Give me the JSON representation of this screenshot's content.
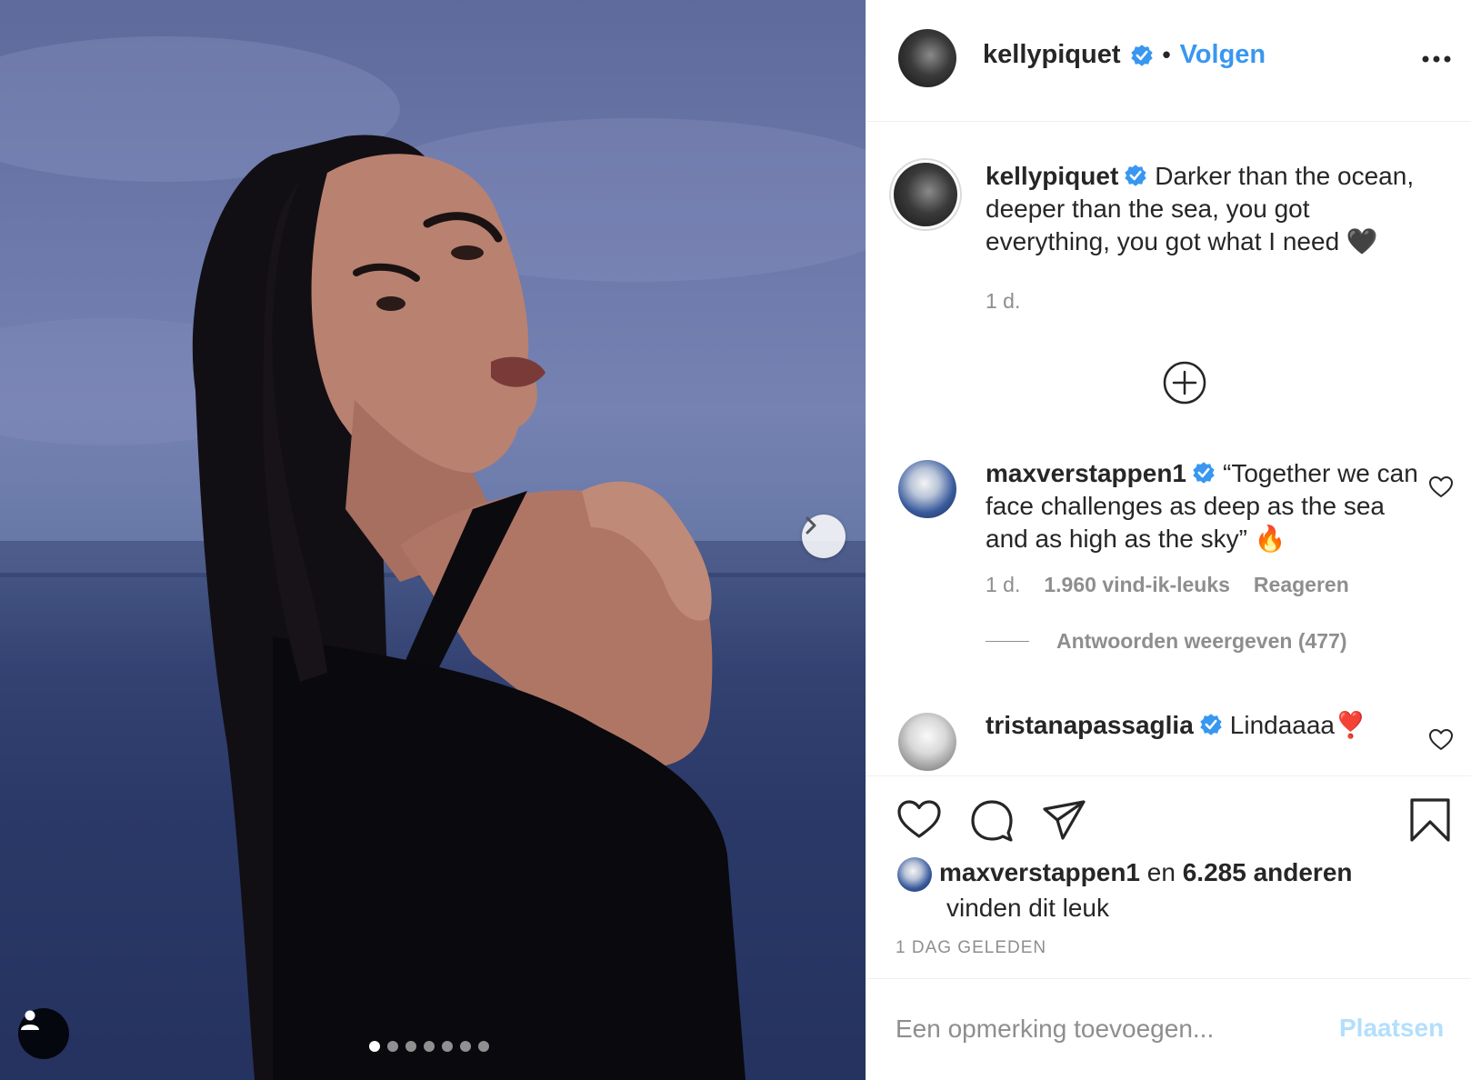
{
  "post": {
    "image_alt": "Woman looking over her shoulder in front of the sea at dusk",
    "carousel": {
      "total_slides": 7,
      "active_index": 0
    }
  },
  "header": {
    "username": "kellypiquet",
    "separator": "•",
    "follow_label": "Volgen"
  },
  "caption": {
    "username": "kellypiquet",
    "text": "Darker than the ocean, deeper than the sea, you got everything, you got what I need 🖤",
    "time": "1 d."
  },
  "comments": [
    {
      "username": "maxverstappen1",
      "text": "“Together we can face challenges as deep as the sea and as high as the sky” 🔥",
      "time": "1 d.",
      "likes": "1.960 vind-ik-leuks",
      "reply_label": "Reageren",
      "view_replies": "Antwoorden weergeven (477)"
    },
    {
      "username": "tristanapassaglia",
      "text": "Lindaaaa❣️"
    }
  ],
  "likes": {
    "first_user": "maxverstappen1",
    "connector": " en ",
    "others": "6.285 anderen",
    "suffix": " vinden dit leuk"
  },
  "timestamp": "1 DAG GELEDEN",
  "add_comment": {
    "placeholder": "Een opmerking toevoegen...",
    "post_label": "Plaatsen"
  },
  "colors": {
    "link_blue": "#3897f0",
    "post_disabled": "#b2dffc",
    "muted_text": "#8e8e8e",
    "verified_blue": "#3897f0"
  }
}
